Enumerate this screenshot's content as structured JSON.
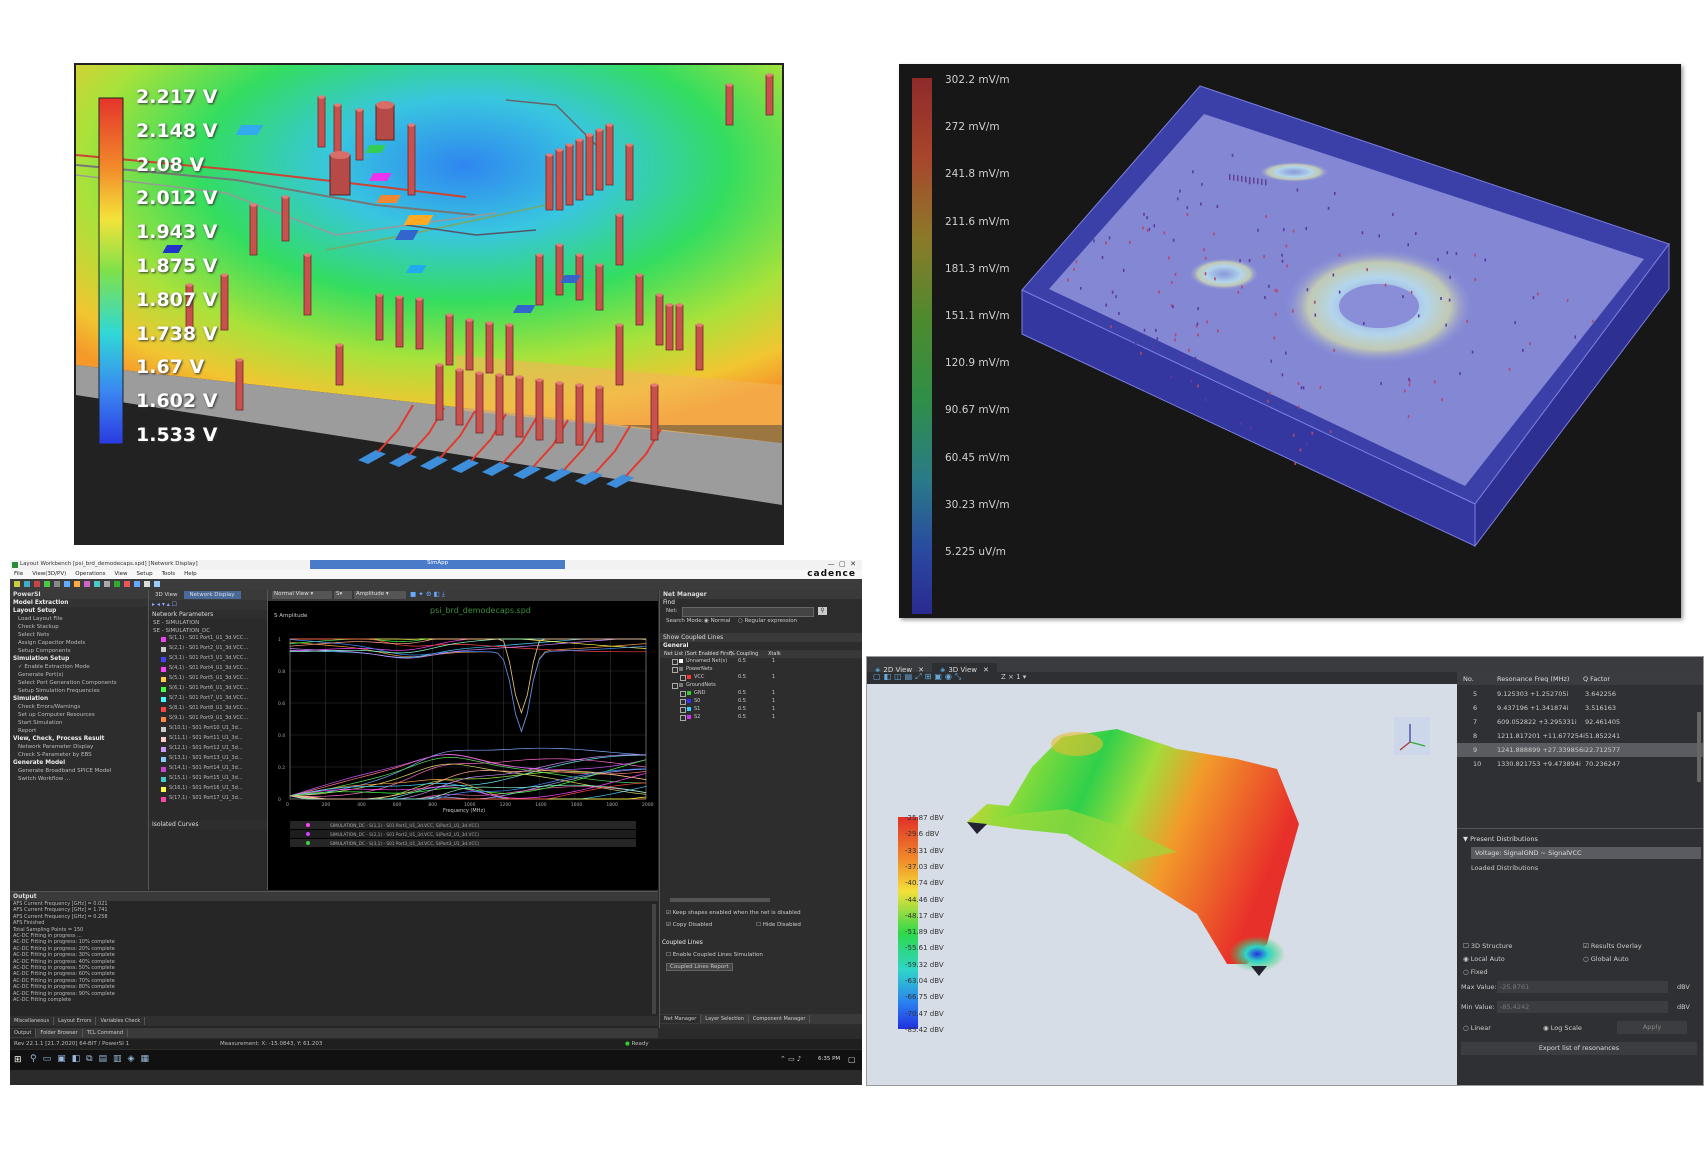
{
  "voltage_panel": {
    "legend_labels": [
      "2.217 V",
      "2.148 V",
      "2.08 V",
      "2.012 V",
      "1.943 V",
      "1.875 V",
      "1.807 V",
      "1.738 V",
      "1.67 V",
      "1.602 V",
      "1.533 V"
    ],
    "colors": {
      "bg_top": "#22d64a",
      "bg_center": "#3aa0f0",
      "bg_right": "#f6c431",
      "floor": "#9a9a9a"
    }
  },
  "efield_panel": {
    "legend_labels": [
      "302.2 mV/m",
      "272 mV/m",
      "241.8 mV/m",
      "211.6 mV/m",
      "181.3 mV/m",
      "151.1 mV/m",
      "120.9 mV/m",
      "90.67 mV/m",
      "60.45 mV/m",
      "30.23 mV/m",
      "5.225 uV/m"
    ],
    "colors": {
      "box": "#6f72c8",
      "edge": "#8a8ee6"
    }
  },
  "workbench": {
    "title": "Layout Workbench [psi_brd_demodecaps.spd] [Network Display]",
    "center_tab": "SimApp",
    "brand": "cadence",
    "menu": [
      "File",
      "View(3D/PV)",
      "Operations",
      "View",
      "Setup",
      "Tools",
      "Help"
    ],
    "left_header": "PowerSI",
    "left_sub": "Model Extraction",
    "workflow": [
      {
        "type": "sect",
        "text": "Layout Setup"
      },
      {
        "type": "item",
        "text": "Load Layout File"
      },
      {
        "type": "item",
        "text": "Check Stackup"
      },
      {
        "type": "item",
        "text": "Select Nets"
      },
      {
        "type": "item",
        "text": "Assign Capacitor Models"
      },
      {
        "type": "item",
        "text": "Setup Components"
      },
      {
        "type": "sect",
        "text": "Simulation Setup"
      },
      {
        "type": "item",
        "text": "✓ Enable Extraction Mode"
      },
      {
        "type": "item",
        "text": "Generate Port(s)"
      },
      {
        "type": "item",
        "text": "Select Port Generation Components"
      },
      {
        "type": "item",
        "text": "Setup Simulation Frequencies"
      },
      {
        "type": "sect",
        "text": "Simulation"
      },
      {
        "type": "item",
        "text": "Check Errors/Warnings"
      },
      {
        "type": "item",
        "text": "Set up Computer Resources"
      },
      {
        "type": "item",
        "text": "Start Simulation"
      },
      {
        "type": "item",
        "text": "Report"
      },
      {
        "type": "sect",
        "text": "View, Check, Process Result"
      },
      {
        "type": "item",
        "text": "Network Parameter Display"
      },
      {
        "type": "item",
        "text": "Check S-Parameter by EBS"
      },
      {
        "type": "sect",
        "text": "Generate Model"
      },
      {
        "type": "item",
        "text": "Generate Broadband SPICE Model"
      },
      {
        "type": "item",
        "text": "Switch Workflow ..."
      }
    ],
    "tabs": [
      "3D View",
      "Network Display"
    ],
    "net_params_header": "Network Parameters",
    "tree": [
      "SE - SIMULATION",
      "SE - SIMULATION_DC"
    ],
    "sparams": [
      "S(1,1) - S01 Port1_U1_3d.VCC...",
      "S(2,1) - S01 Port2_U1_3d.VCC...",
      "S(3,1) - S01 Port3_U1_3d.VCC...",
      "S(4,1) - S01 Port4_U1_3d.VCC...",
      "S(5,1) - S01 Port5_U1_3d.VCC...",
      "S(6,1) - S01 Port6_U1_3d.VCC...",
      "S(7,1) - S01 Port7_U1_3d.VCC...",
      "S(8,1) - S01 Port8_U1_3d.VCC...",
      "S(9,1) - S01 Port9_U1_3d.VCC...",
      "S(10,1) - S01 Port10_U1_3d...",
      "S(11,1) - S01 Port11_U1_3d...",
      "S(12,1) - S01 Port12_U1_3d...",
      "S(13,1) - S01 Port13_U1_3d...",
      "S(14,1) - S01 Port14_U1_3d...",
      "S(15,1) - S01 Port15_U1_3d...",
      "S(16,1) - S01 Port16_U1_3d...",
      "S(17,1) - S01 Port17_U1_3d..."
    ],
    "isolated_curves": "Isolated Curves",
    "toolbar_view": "Normal View",
    "toolbar_s": "S",
    "toolbar_amp": "Amplitude",
    "plot_title": "psi_brd_demodecaps.spd",
    "plot_ylabel": "S Amplitude",
    "plot_xlabel": "Frequency (MHz)",
    "x_ticks": [
      "0",
      "200",
      "400",
      "600",
      "800",
      "1000",
      "1200",
      "1400",
      "1600",
      "1800",
      "2000"
    ],
    "y_ticks": [
      "1",
      "0.8",
      "0.6",
      "0.4",
      "0.2",
      "0"
    ],
    "curve_list": [
      "SIMULATION_DC - S(1,1) - S01 Port1_U1_3d.VCC, S(Port1_U1_3d.VCC)",
      "SIMULATION_DC - S(2,1) - S01 Port2_U1_3d.VCC, S(Port2_U1_3d.VCC)",
      "SIMULATION_DC - S(3,1) - S01 Port3_U1_3d.VCC, S(Port3_U1_3d.VCC)"
    ],
    "net_manager": "Net Manager",
    "find": "Find",
    "net_label": "Net:",
    "search_mode": "Search Mode:",
    "normal": "Normal",
    "regex": "Regular expression",
    "show_coupled": "Show Coupled Lines",
    "general": "General",
    "net_table_headers": [
      "Net List (Sort Enabled First)",
      "% Coupling",
      "Xtalk"
    ],
    "net_rows": [
      [
        "Unnamed Net(s)",
        "0.5",
        "1"
      ],
      [
        "PowerNets",
        "",
        ""
      ],
      [
        "VCC",
        "0.5",
        "1"
      ],
      [
        "GroundNets",
        "",
        ""
      ],
      [
        "GND",
        "0.5",
        "1"
      ],
      [
        "S0",
        "0.5",
        "1"
      ],
      [
        "S1",
        "0.5",
        "1"
      ],
      [
        "S2",
        "0.5",
        "1"
      ]
    ],
    "keep_shapes": "Keep shapes enabled when the net is disabled",
    "copy_disabled": "Copy Disabled",
    "hide_disabled": "Hide Disabled",
    "coupled_lines": "Coupled Lines",
    "enable_coupled": "Enable Coupled Lines Simulation",
    "coupled_report": "Coupled Lines Report",
    "output_header": "Output",
    "output_lines": [
      "AFS Current Frequency [GHz] = 0.021",
      "AFS Current Frequency [GHz] = 1.741",
      "AFS Current Frequency [GHz] = 0.258",
      "AFS Finished",
      "Total Sampling Points = 150",
      "AC-DC Fitting in progress ...",
      "AC-DC Fitting in progress: 10% complete",
      "AC-DC Fitting in progress: 20% complete",
      "AC-DC Fitting in progress: 30% complete",
      "AC-DC Fitting in progress: 40% complete",
      "AC-DC Fitting in progress: 50% complete",
      "AC-DC Fitting in progress: 60% complete",
      "AC-DC Fitting in progress: 70% complete",
      "AC-DC Fitting in progress: 80% complete",
      "AC-DC Fitting in progress: 90% complete",
      "AC-DC Fitting complete"
    ],
    "bottom_tabs1": [
      "Miscellaneous",
      "Layout Errors",
      "Variables Check"
    ],
    "bottom_tabs2": [
      "Output",
      "Folder Browser",
      "TCL Command"
    ],
    "right_tabs": [
      "Net Manager",
      "Layer Selection",
      "Component Manager"
    ],
    "status_left": "Rev 22.1.1 [21.7.2020] 64-BIT / PowerSI 1",
    "status_mid": "Measurement: X: -15.0843, Y: 61.203",
    "status_ready": "Ready",
    "clock": "6:35 PM"
  },
  "resonance": {
    "tabs": [
      "2D View",
      "3D View"
    ],
    "zoom": "Z × 1",
    "legend_labels": [
      "-25.87 dBV",
      "-29.6 dBV",
      "-33.31 dBV",
      "-37.03 dBV",
      "-40.74 dBV",
      "-44.46 dBV",
      "-48.17 dBV",
      "-51.89 dBV",
      "-55.61 dBV",
      "-59.32 dBV",
      "-63.04 dBV",
      "-66.75 dBV",
      "-70.47 dBV",
      "-85.42 dBV"
    ],
    "table_headers": [
      "No.",
      "Resonance Freq (MHz)",
      "Q Factor"
    ],
    "table_rows": [
      [
        "5",
        "9.125303 +1.252705i",
        "3.642256"
      ],
      [
        "6",
        "9.437196 +1.341874i",
        "3.516163"
      ],
      [
        "7",
        "609.052822 +3.295331i",
        "92.461405"
      ],
      [
        "8",
        "1211.817201 +11.677254i",
        "51.852241"
      ],
      [
        "9",
        "1241.888899 +27.339856i",
        "22.712577"
      ],
      [
        "10",
        "1330.821753 +9.473894i",
        "70.236247"
      ]
    ],
    "present_dist": "Present Distributions",
    "voltage_item": "Voltage: SignalGND ~ SignalVCC",
    "loaded_dist": "Loaded Distributions",
    "opt_3d_structure": "3D Structure",
    "opt_results_overlay": "Results Overlay",
    "opt_local_auto": "Local Auto",
    "opt_global_auto": "Global Auto",
    "opt_fixed": "Fixed",
    "max_value_label": "Max Value:",
    "max_value": "-25.8761",
    "min_value_label": "Min Value:",
    "min_value": "-85.4242",
    "unit": "dBV",
    "linear": "Linear",
    "log_scale": "Log Scale",
    "apply": "Apply",
    "export": "Export list of resonances"
  }
}
